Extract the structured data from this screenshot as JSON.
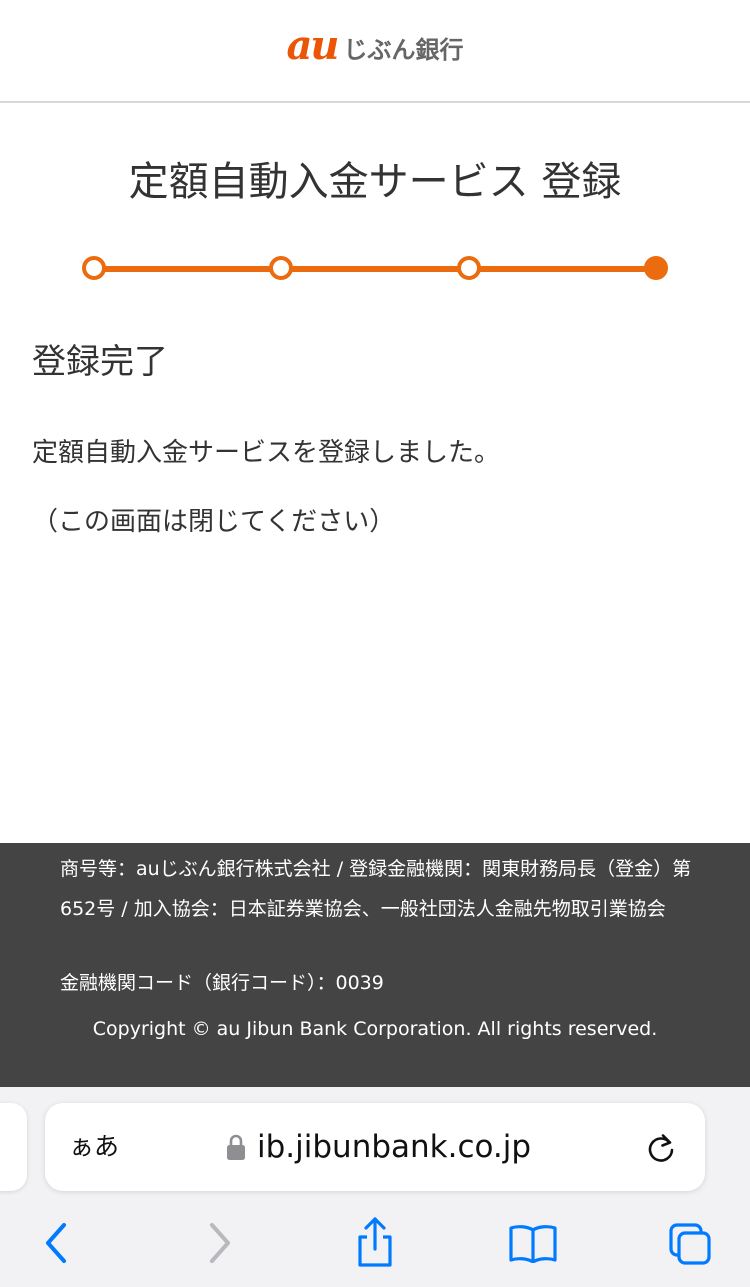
{
  "header": {
    "logo_mark": "au",
    "logo_name": "じぶん銀行",
    "brand_color": "#eb5505"
  },
  "page": {
    "title": "定額自動入金サービス 登録",
    "steps_total": 4,
    "current_step": 4
  },
  "content": {
    "heading": "登録完了",
    "message": "定額自動入金サービスを登録しました。",
    "note": "（この画面は閉じてください）"
  },
  "footer": {
    "legal": "商号等：auじぶん銀行株式会社 / 登録金融機関：関東財務局長（登金）第652号 / 加入協会：日本証券業協会、一般社団法人金融先物取引業協会",
    "bank_code": "金融機関コード（銀行コード）：0039",
    "copyright": "Copyright © au Jibun Bank Corporation. All rights reserved."
  },
  "browser": {
    "text_size_label": "ぁあ",
    "url": "ib.jibunbank.co.jp",
    "icons": {
      "lock": "lock-icon",
      "reload": "reload-icon",
      "back": "back-icon",
      "forward": "forward-icon",
      "share": "share-icon",
      "bookmarks": "bookmarks-icon",
      "tabs": "tabs-icon"
    },
    "accent_color": "#007aff"
  }
}
